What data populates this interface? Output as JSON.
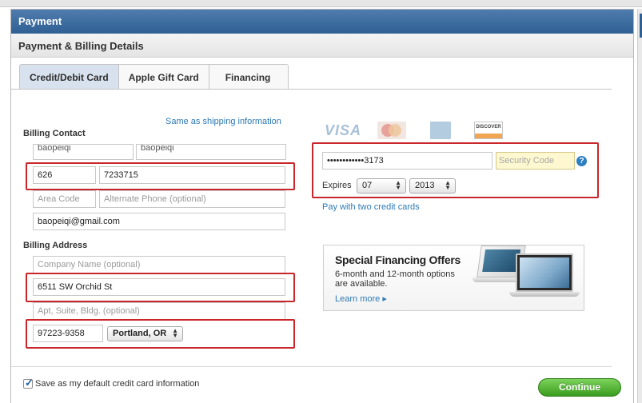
{
  "header": {
    "title": "Payment",
    "subtitle": "Payment & Billing Details"
  },
  "tabs": [
    {
      "label": "Credit/Debit Card",
      "active": true
    },
    {
      "label": "Apple Gift Card",
      "active": false
    },
    {
      "label": "Financing",
      "active": false
    }
  ],
  "billing_contact": {
    "heading": "Billing Contact",
    "same_as_shipping_link": "Same as shipping information",
    "first_name": "baopeiqi",
    "last_name": "baopeiqi",
    "area_code": "626",
    "phone": "7233715",
    "alt_area_code_placeholder": "Area Code",
    "alt_phone_placeholder": "Alternate Phone (optional)",
    "email": "baopeiqi@gmail.com"
  },
  "billing_address": {
    "heading": "Billing Address",
    "company_placeholder": "Company Name (optional)",
    "street": "6511 SW Orchid St",
    "apt_placeholder": "Apt, Suite, Bldg. (optional)",
    "zip": "97223-9358",
    "city_state": "Portland, OR"
  },
  "card": {
    "brands": [
      "VISA",
      "MasterCard",
      "American Express",
      "DISCOVER"
    ],
    "visa_text": "VISA",
    "discover_text": "DISCOVER",
    "number": "••••••••••••3173",
    "security_code_placeholder": "Security Code",
    "help_label": "?",
    "expires_label": "Expires",
    "exp_month": "07",
    "exp_year": "2013",
    "two_cards_link": "Pay with two credit cards"
  },
  "promo": {
    "title": "Special Financing Offers",
    "description": "6-month and 12-month options are available.",
    "link": "Learn more"
  },
  "footer": {
    "save_default_label": "Save as my default credit card information",
    "save_default_checked": true,
    "continue_label": "Continue"
  },
  "colors": {
    "header_blue": "#2f5f93",
    "highlight_red": "#c8262b",
    "link_blue": "#2e7ab5",
    "continue_green": "#3a9c1f",
    "security_code_bg": "#fdf8cf"
  }
}
